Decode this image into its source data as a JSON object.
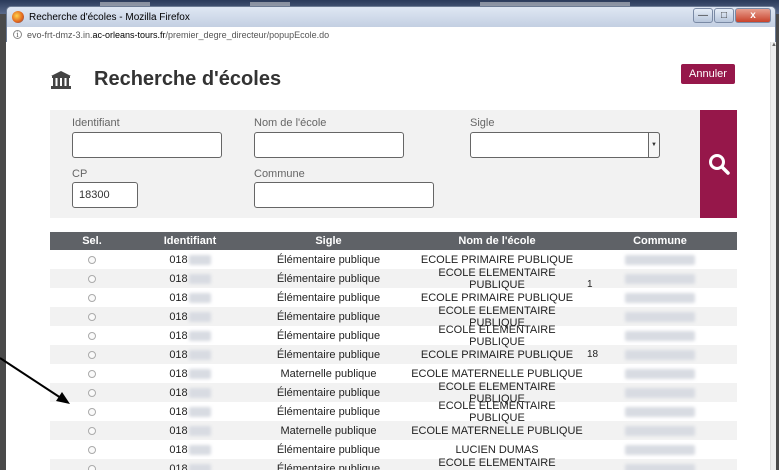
{
  "window": {
    "title": "Recherche d'écoles - Mozilla Firefox",
    "min": "—",
    "max": "□",
    "close": "x"
  },
  "urlbar": {
    "info": "i",
    "prefix": "evo-frt-dmz-3.in.",
    "host": "ac-orleans-tours.fr",
    "path": "/premier_degre_directeur/popupEcole.do"
  },
  "page": {
    "title": "Recherche d'écoles",
    "cancel_label": "Annuler"
  },
  "form": {
    "identifiant_label": "Identifiant",
    "identifiant_value": "",
    "nom_label": "Nom de l'école",
    "nom_value": "",
    "sigle_label": "Sigle",
    "sigle_value": "",
    "cp_label": "CP",
    "cp_value": "18300",
    "commune_label": "Commune",
    "commune_value": ""
  },
  "table": {
    "headers": [
      "Sel.",
      "Identifiant",
      "Sigle",
      "Nom de l'école",
      "Commune"
    ],
    "rows": [
      {
        "id": "018",
        "sigle": "Élémentaire publique",
        "nom": "ECOLE PRIMAIRE PUBLIQUE",
        "extra": ""
      },
      {
        "id": "018",
        "sigle": "Élémentaire publique",
        "nom": "ECOLE ELEMENTAIRE PUBLIQUE",
        "extra": "1"
      },
      {
        "id": "018",
        "sigle": "Élémentaire publique",
        "nom": "ECOLE PRIMAIRE PUBLIQUE",
        "extra": ""
      },
      {
        "id": "018",
        "sigle": "Élémentaire publique",
        "nom": "ECOLE ELEMENTAIRE PUBLIQUE",
        "extra": ""
      },
      {
        "id": "018",
        "sigle": "Élémentaire publique",
        "nom": "ECOLE ELEMENTAIRE PUBLIQUE",
        "extra": ""
      },
      {
        "id": "018",
        "sigle": "Élémentaire publique",
        "nom": "ECOLE PRIMAIRE PUBLIQUE",
        "extra": "18"
      },
      {
        "id": "018",
        "sigle": "Maternelle publique",
        "nom": "ECOLE MATERNELLE PUBLIQUE",
        "extra": ""
      },
      {
        "id": "018",
        "sigle": "Élémentaire publique",
        "nom": "ECOLE ELEMENTAIRE PUBLIQUE",
        "extra": ""
      },
      {
        "id": "018",
        "sigle": "Élémentaire publique",
        "nom": "ECOLE ELEMENTAIRE PUBLIQUE",
        "extra": ""
      },
      {
        "id": "018",
        "sigle": "Maternelle publique",
        "nom": "ECOLE MATERNELLE PUBLIQUE",
        "extra": ""
      },
      {
        "id": "018",
        "sigle": "Élémentaire publique",
        "nom": "LUCIEN DUMAS",
        "extra": ""
      },
      {
        "id": "018",
        "sigle": "Élémentaire publique",
        "nom": "ECOLE ELEMENTAIRE PUBLIQUE",
        "extra": ""
      }
    ]
  },
  "colors": {
    "accent": "#96174a",
    "table_header": "#5f6267",
    "annotation": "#000000"
  }
}
